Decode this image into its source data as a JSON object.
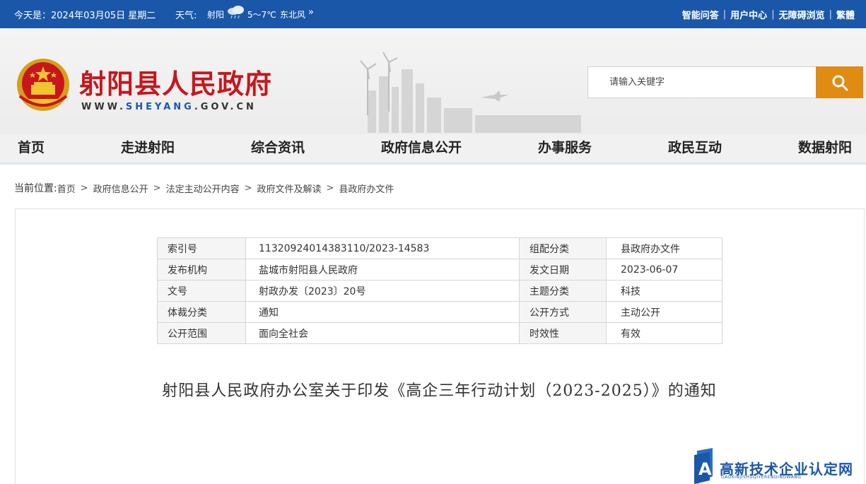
{
  "topbar": {
    "date": "今天是：2024年03月05日 星期二",
    "weather_label": "天气:",
    "city": "射阳",
    "temperature": "5～7℃",
    "wind": "东北风",
    "more": "»",
    "links": [
      "智能问答",
      "用户中心",
      "无障碍浏览",
      "繁體"
    ]
  },
  "header": {
    "site_title": "射阳县人民政府",
    "url_prefix": "WWW.",
    "url_brand": "SHEYANG",
    "url_suffix": ".GOV.CN",
    "search_placeholder": "请输入关键字"
  },
  "nav": {
    "items": [
      "首页",
      "走进射阳",
      "综合资讯",
      "政府信息公开",
      "办事服务",
      "政民互动",
      "数据射阳"
    ]
  },
  "breadcrumb": {
    "lead": "当前位置:",
    "items": [
      "首页",
      "政府信息公开",
      "法定主动公开内容",
      "政府文件及解读",
      "县政府办文件"
    ],
    "separator": ">"
  },
  "meta": {
    "rows": [
      {
        "k1": "索引号",
        "v1": "11320924014383110/2023-14583",
        "k2": "组配分类",
        "v2": "县政府办文件"
      },
      {
        "k1": "发布机构",
        "v1": "盐城市射阳县人民政府",
        "k2": "发文日期",
        "v2": "2023-06-07"
      },
      {
        "k1": "文号",
        "v1": "射政办发〔2023〕20号",
        "k2": "主题分类",
        "v2": "科技"
      },
      {
        "k1": "体裁分类",
        "v1": "通知",
        "k2": "公开方式",
        "v2": "主动公开"
      },
      {
        "k1": "公开范围",
        "v1": "面向全社会",
        "k2": "时效性",
        "v2": "有效"
      }
    ]
  },
  "document": {
    "title": "射阳县人民政府办公室关于印发《高企三年行动计划（2023-2025）》的通知"
  },
  "watermark": {
    "text": "高新技术企业认定网",
    "sub": "GAOXINJISHUQIYERENDINGWANG"
  },
  "colors": {
    "topbar": "#1b57a8",
    "title_red": "#c8161d",
    "search_button": "#e08b11",
    "brand_blue": "#1b57a8"
  },
  "icons": [
    "weather-cloud-icon",
    "search-icon",
    "national-emblem",
    "watermark-logo-icon"
  ]
}
